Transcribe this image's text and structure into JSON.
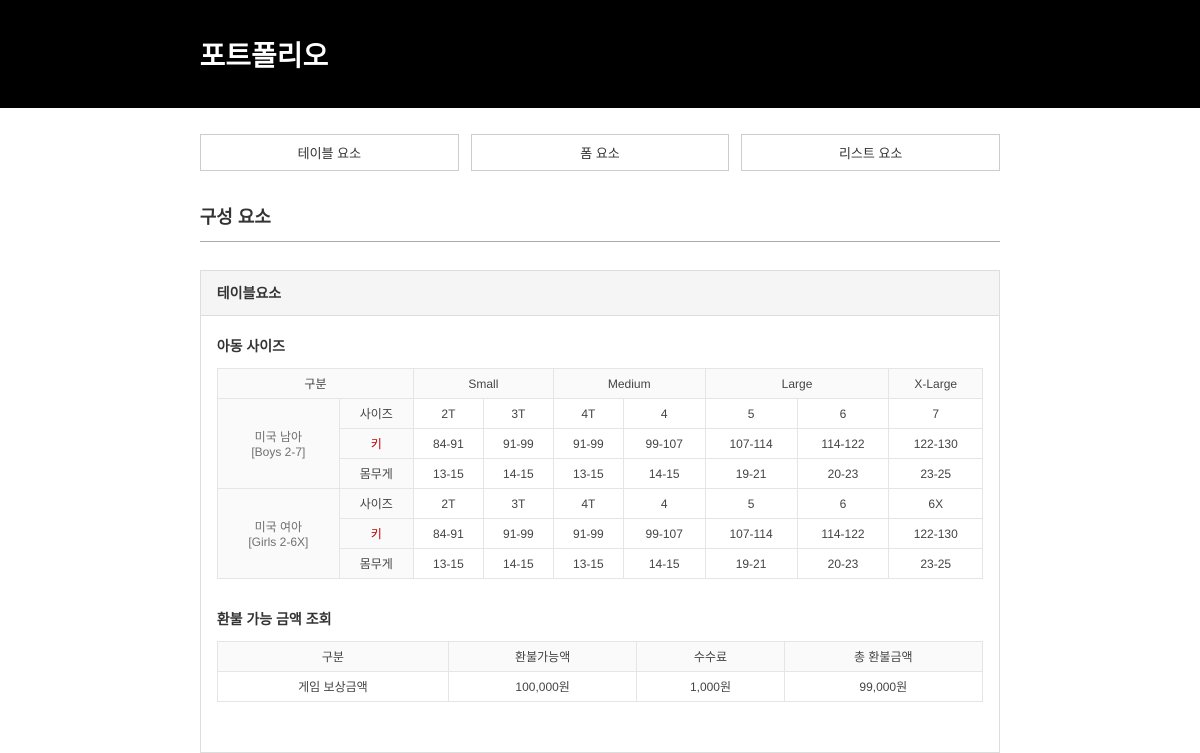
{
  "header": {
    "title": "포트폴리오"
  },
  "tabs": [
    {
      "label": "테이블 요소"
    },
    {
      "label": "폼 요소"
    },
    {
      "label": "리스트 요소"
    }
  ],
  "section": {
    "title": "구성 요소"
  },
  "panel": {
    "title": "테이블요소"
  },
  "sizeTable": {
    "title": "아동 사이즈",
    "headers": {
      "gubun": "구분",
      "small": "Small",
      "medium": "Medium",
      "large": "Large",
      "xlarge": "X-Large"
    },
    "rowLabels": {
      "boys": "미국 남아",
      "boysSub": "[Boys 2-7]",
      "girls": "미국 여아",
      "girlsSub": "[Girls 2-6X]",
      "size": "사이즈",
      "height": "키",
      "weight": "몸무게"
    },
    "boys": {
      "size": [
        "2T",
        "3T",
        "4T",
        "4",
        "5",
        "6",
        "7"
      ],
      "height": [
        "84-91",
        "91-99",
        "91-99",
        "99-107",
        "107-114",
        "114-122",
        "122-130"
      ],
      "weight": [
        "13-15",
        "14-15",
        "13-15",
        "14-15",
        "19-21",
        "20-23",
        "23-25"
      ]
    },
    "girls": {
      "size": [
        "2T",
        "3T",
        "4T",
        "4",
        "5",
        "6",
        "6X"
      ],
      "height": [
        "84-91",
        "91-99",
        "91-99",
        "99-107",
        "107-114",
        "114-122",
        "122-130"
      ],
      "weight": [
        "13-15",
        "14-15",
        "13-15",
        "14-15",
        "19-21",
        "20-23",
        "23-25"
      ]
    }
  },
  "refundTable": {
    "title": "환불 가능 금액 조회",
    "headers": {
      "gubun": "구분",
      "available": "환불가능액",
      "fee": "수수료",
      "total": "총 환불금액"
    },
    "rows": [
      {
        "label": "게임 보상금액",
        "available": "100,000원",
        "fee": "1,000원",
        "total": "99,000원"
      }
    ]
  }
}
